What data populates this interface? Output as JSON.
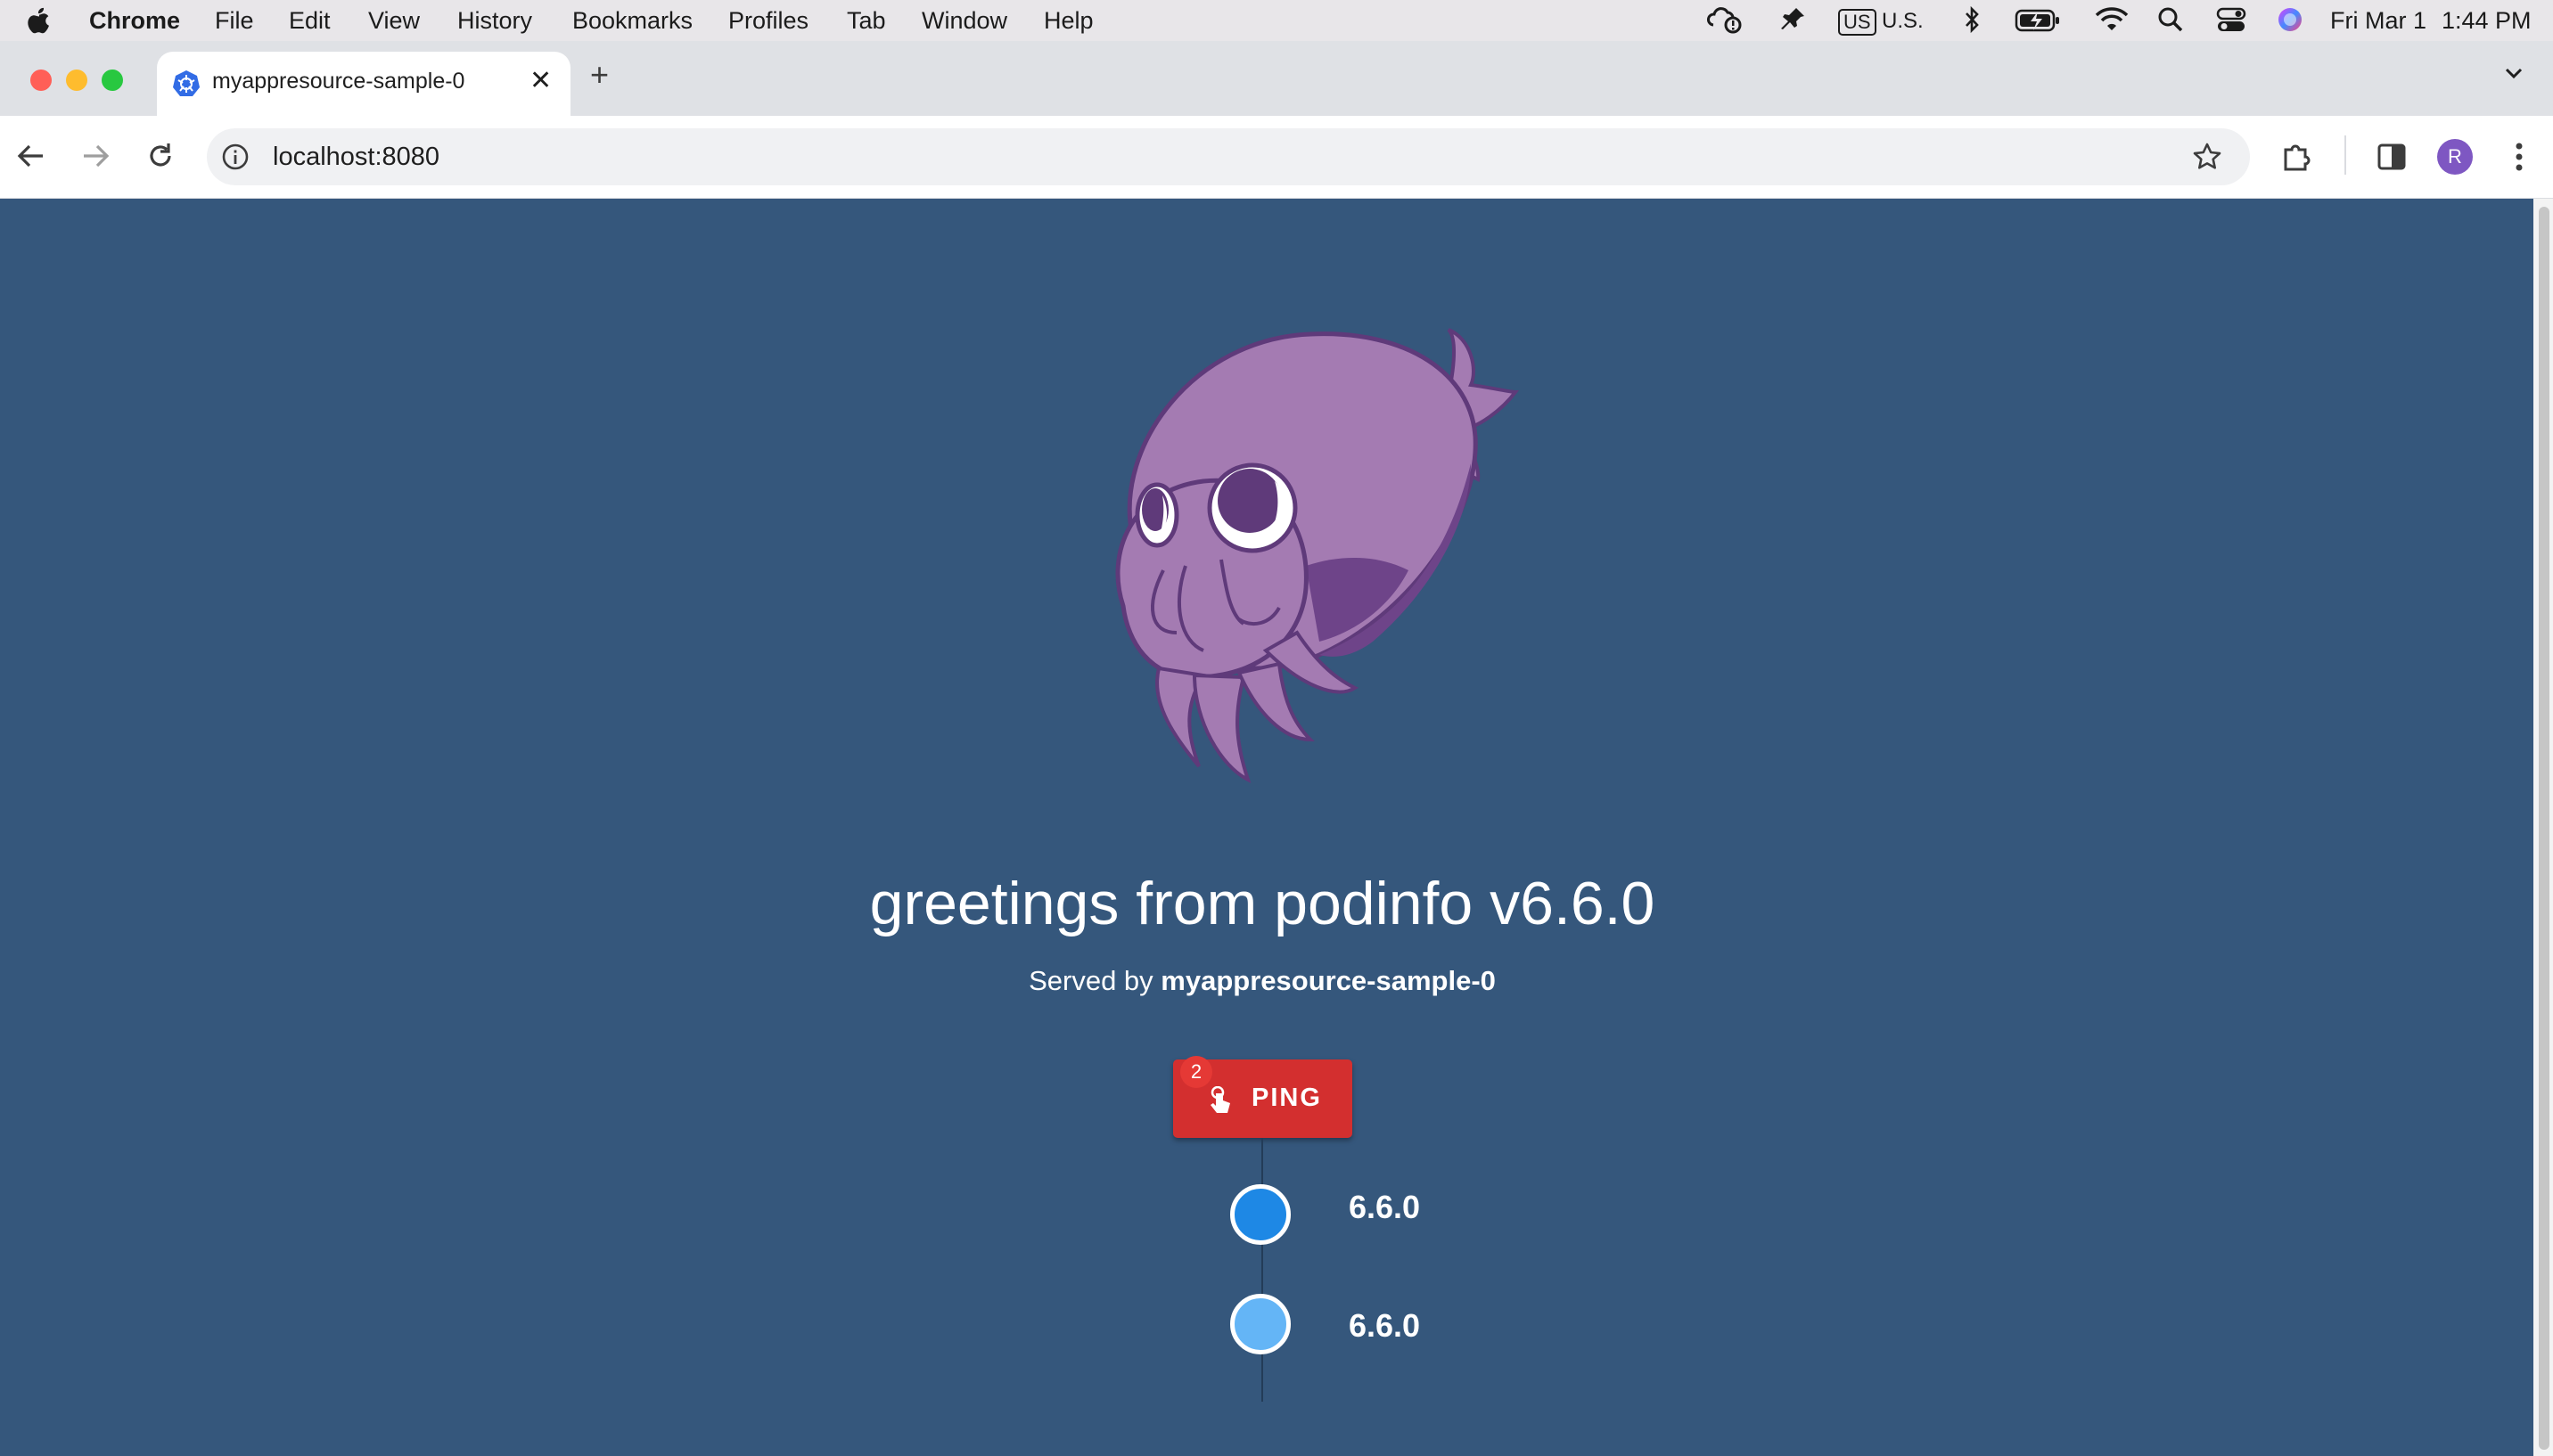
{
  "menubar": {
    "app": "Chrome",
    "items": [
      "File",
      "Edit",
      "View",
      "History",
      "Bookmarks",
      "Profiles",
      "Tab",
      "Window",
      "Help"
    ],
    "input_source_badge": "US",
    "input_source": "U.S.",
    "date": "Fri Mar 1",
    "time": "1:44 PM"
  },
  "tab": {
    "title": "myappresource-sample-0"
  },
  "toolbar": {
    "url": "localhost:8080",
    "avatar_letter": "R"
  },
  "page": {
    "heading": "greetings from podinfo v6.6.0",
    "served_prefix": "Served by",
    "served_host": "myappresource-sample-0",
    "ping_label": "PING",
    "ping_badge": "2",
    "timeline": [
      {
        "version": "6.6.0",
        "color": "#1e88e5"
      },
      {
        "version": "6.6.0",
        "color": "#64b5f6"
      }
    ]
  },
  "colors": {
    "page_bg": "#35577c",
    "ping_button": "#d32f2f",
    "mascot": "#a47bb2"
  }
}
